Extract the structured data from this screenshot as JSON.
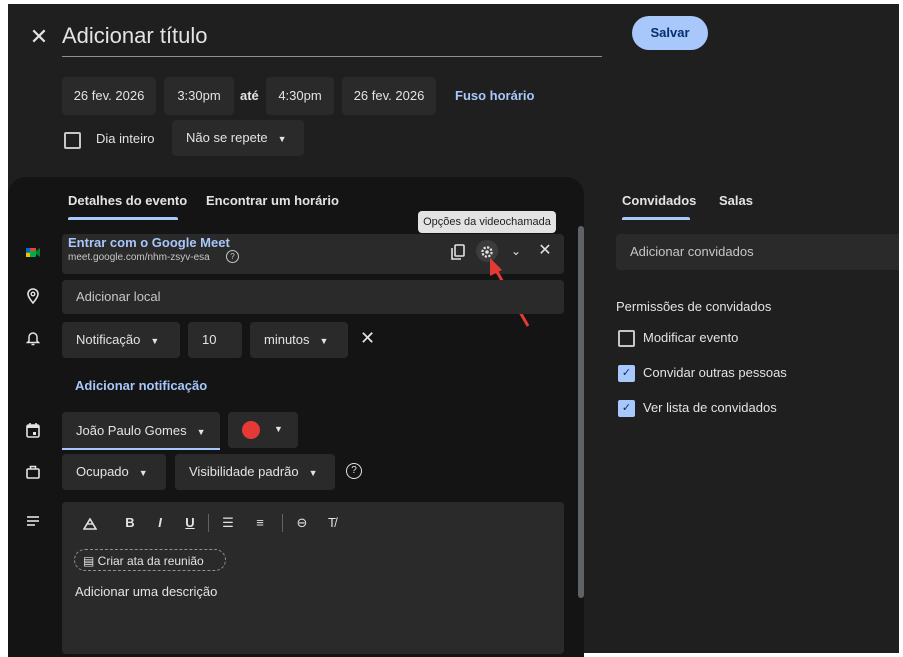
{
  "header": {
    "title_placeholder": "Adicionar título",
    "save_label": "Salvar"
  },
  "datetime": {
    "start_date": "26 fev. 2026",
    "start_time": "3:30pm",
    "separator": "até",
    "end_time": "4:30pm",
    "end_date": "26 fev. 2026",
    "timezone_link": "Fuso horário",
    "all_day_label": "Dia inteiro",
    "all_day_checked": false,
    "repeat_value": "Não se repete"
  },
  "tabs": {
    "details": "Detalhes do evento",
    "find_time": "Encontrar um horário"
  },
  "tooltip": "Opções da videochamada",
  "meet": {
    "title": "Entrar com o Google Meet",
    "link": "meet.google.com/nhm-zsyv-esa"
  },
  "location": {
    "placeholder": "Adicionar local"
  },
  "notification": {
    "type": "Notificação",
    "amount": "10",
    "unit": "minutos",
    "add_label": "Adicionar notificação"
  },
  "calendar": {
    "owner": "João Paulo Gomes",
    "color": "#e53935"
  },
  "availability": {
    "status": "Ocupado",
    "visibility": "Visibilidade padrão"
  },
  "description": {
    "notes_chip": "Criar ata da reunião",
    "placeholder": "Adicionar uma descrição"
  },
  "right_panel": {
    "tab_guests": "Convidados",
    "tab_rooms": "Salas",
    "guest_placeholder": "Adicionar convidados",
    "permissions_title": "Permissões de convidados",
    "permissions": [
      {
        "label": "Modificar evento",
        "checked": false
      },
      {
        "label": "Convidar outras pessoas",
        "checked": true
      },
      {
        "label": "Ver lista de convidados",
        "checked": true
      }
    ]
  },
  "colors": {
    "accent": "#a8c7fa",
    "background": "#1f1f1f",
    "panel": "#141414",
    "field": "#2a2a2a",
    "annotation_arrow": "#e53935"
  }
}
